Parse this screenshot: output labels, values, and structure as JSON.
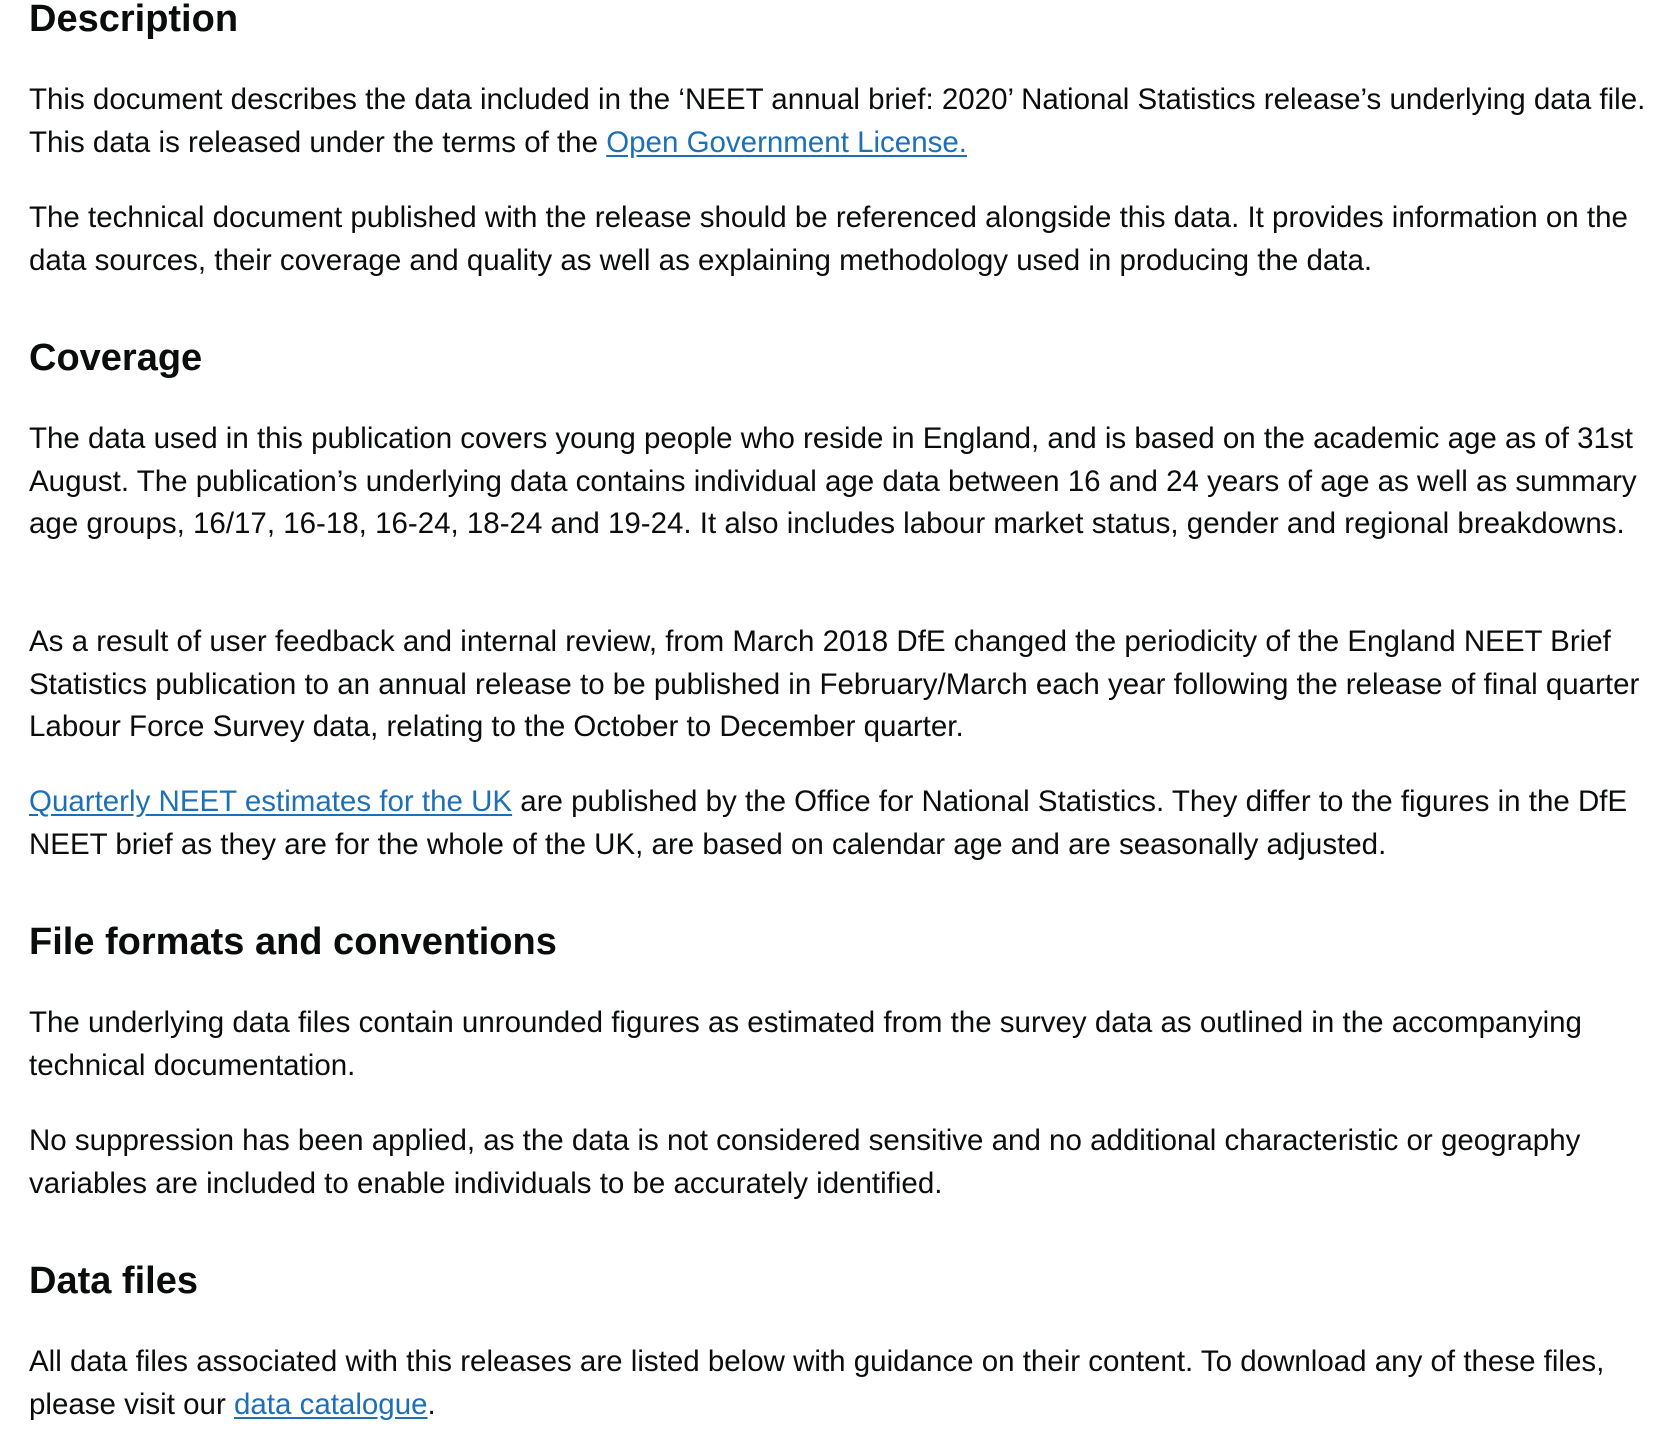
{
  "description": {
    "heading": "Description",
    "para1": {
      "text_before": "This document describes the data included in the ‘NEET annual brief: 2020’ National Statistics release’s underlying data file. This data is released under the terms of the ",
      "link": "Open Government License.",
      "text_after": ""
    },
    "para2": "The technical document published with the release should be referenced alongside this data. It provides information on the data sources, their coverage and quality as well as explaining methodology used in producing the data."
  },
  "coverage": {
    "heading": "Coverage",
    "para1": "The data used in this publication covers young people who reside in England, and is based on the academic age as of 31st August. The publication’s underlying data contains individual age data between 16 and 24 years of age as well as summary age groups, 16/17, 16-18, 16-24, 18-24 and 19-24. It also includes labour market status, gender and regional breakdowns.",
    "para2": "As a result of user feedback and internal review, from March 2018 DfE changed the periodicity of the England NEET Brief Statistics publication to an annual release to be published in February/March each year following the release of final quarter Labour Force Survey data, relating to the October to December quarter.",
    "para3": {
      "link": "Quarterly NEET estimates for the UK",
      "text_after": " are published by the Office for National Statistics. They differ to the figures in the DfE NEET brief as they are for the whole of the UK, are based on calendar age and are seasonally adjusted."
    }
  },
  "file_formats": {
    "heading": "File formats and conventions",
    "para1": "The underlying data files contain unrounded figures as estimated from the survey data as outlined in the accompanying technical documentation.",
    "para2": "No suppression has been applied, as the data is not considered sensitive and no additional characteristic or geography variables are included to enable individuals to be accurately identified."
  },
  "data_files": {
    "heading": "Data files",
    "para1": {
      "text_before": "All data files associated with this releases are listed below with guidance on their content. To download any of these files, please visit our ",
      "link": "data catalogue",
      "text_after": "."
    }
  },
  "colors": {
    "text": "#0b0c0c",
    "link": "#1d70b8",
    "background": "#ffffff"
  }
}
